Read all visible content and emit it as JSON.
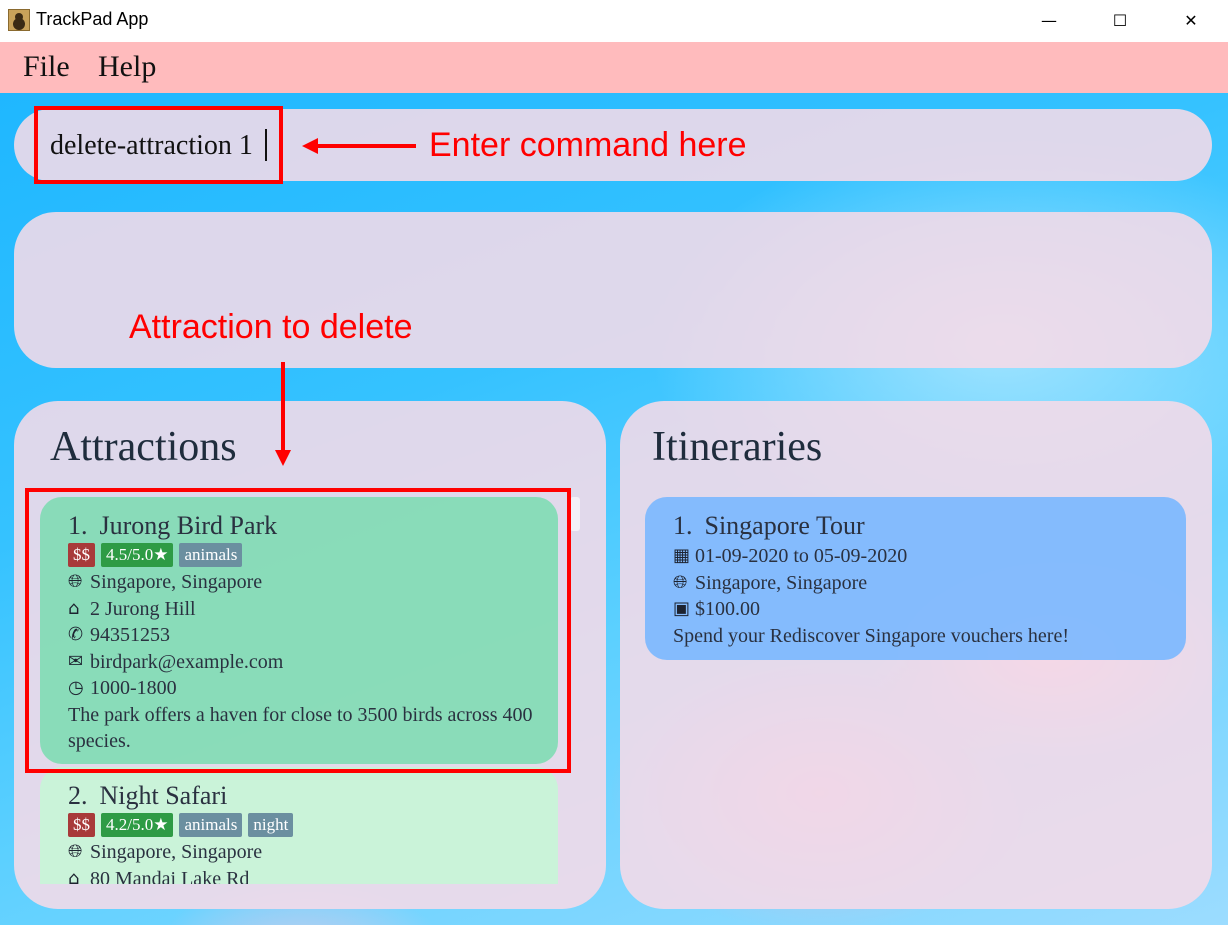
{
  "window": {
    "title": "TrackPad App",
    "minimize": "—",
    "maximize": "☐",
    "close": "✕"
  },
  "menu": {
    "items": [
      "File",
      "Help"
    ]
  },
  "command": {
    "value": "delete-attraction 1"
  },
  "annotations": {
    "command_hint": "Enter command here",
    "delete_hint": "Attraction to delete"
  },
  "attractions": {
    "title": "Attractions",
    "items": [
      {
        "index": "1.",
        "name": "Jurong Bird Park",
        "price": "$$",
        "rating": "4.5/5.0★",
        "tags": [
          "animals"
        ],
        "location": "Singapore, Singapore",
        "address": "2 Jurong Hill",
        "phone": "94351253",
        "email": "birdpark@example.com",
        "hours": "1000-1800",
        "description": "The park offers a haven for close to 3500 birds across 400 species."
      },
      {
        "index": "2.",
        "name": "Night Safari",
        "price": "$$",
        "rating": "4.2/5.0★",
        "tags": [
          "animals",
          "night"
        ],
        "location": "Singapore, Singapore",
        "address": "80 Mandai Lake Rd"
      }
    ]
  },
  "itineraries": {
    "title": "Itineraries",
    "items": [
      {
        "index": "1.",
        "name": "Singapore Tour",
        "dates": "01-09-2020 to 05-09-2020",
        "location": "Singapore, Singapore",
        "budget": "$100.00",
        "description": "Spend your Rediscover Singapore vouchers here!"
      }
    ]
  },
  "icons": {
    "location": "globe-icon",
    "address": "home-icon",
    "phone": "phone-icon",
    "email": "email-icon",
    "hours": "clock-icon",
    "dates": "calendar-icon",
    "budget": "money-icon"
  },
  "colors": {
    "menubar": "#ffbbbd",
    "annotation": "#ff0000",
    "attraction_selected": "#80dcb4",
    "itinerary_card": "#76b6ff"
  }
}
